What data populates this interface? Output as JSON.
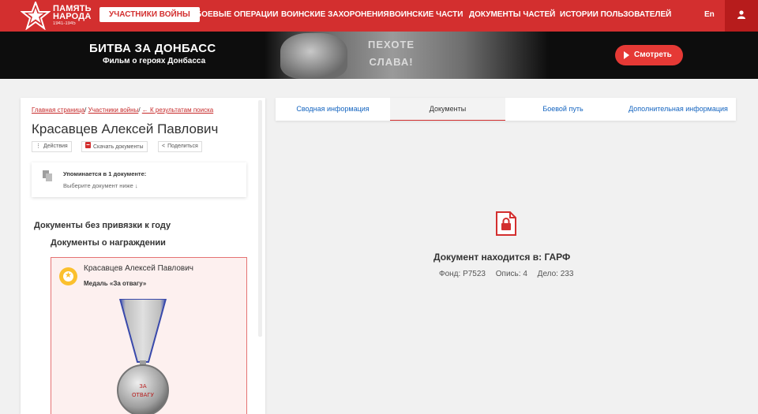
{
  "nav": {
    "logo": {
      "line1": "ПАМЯТЬ",
      "line2": "НАРОДА",
      "years": "1941-1945"
    },
    "items": [
      {
        "label": "УЧАСТНИКИ ВОЙНЫ"
      },
      {
        "label": "БОЕВЫЕ ОПЕРАЦИИ"
      },
      {
        "label": "ВОИНСКИЕ ЗАХОРОНЕНИЯ"
      },
      {
        "label": "ВОИНСКИЕ ЧАСТИ"
      },
      {
        "label": "ДОКУМЕНТЫ ЧАСТЕЙ"
      },
      {
        "label": "ИСТОРИИ ПОЛЬЗОВАТЕЛЕЙ"
      }
    ],
    "lang": "En",
    "icons": {
      "user": "user-icon"
    }
  },
  "banner": {
    "title": "БИТВА ЗА ДОНБАСС",
    "subtitle": "Фильм о героях Донбасса",
    "engrave_line1": "ПЕХОТЕ",
    "engrave_line2": "СЛАВА!",
    "button": "Смотреть"
  },
  "breadcrumb": {
    "home": "Главная страница",
    "section": "Участники войны",
    "back": "← К результатам поиска",
    "separator": "/"
  },
  "person": {
    "name": "Красавцев Алексей Павлович",
    "actions": {
      "menu": "Действия",
      "download": "Скачать документы",
      "share": "Поделиться"
    }
  },
  "mention": {
    "title": "Упоминается в 1 документе:",
    "hint": "Выберите документ ниже ↓"
  },
  "documents": {
    "year_group": "Документы без привязки к году",
    "category": "Документы о награждении",
    "award": {
      "name": "Красавцев Алексей Павлович",
      "medal": "Медаль «За отвагу»",
      "medal_inscription_1": "ЗА",
      "medal_inscription_2": "ОТВАГУ"
    }
  },
  "tabs": [
    {
      "label": "Сводная информация"
    },
    {
      "label": "Документы"
    },
    {
      "label": "Боевой путь"
    },
    {
      "label": "Дополнительная информация"
    }
  ],
  "document_view": {
    "location": "Документ находится в: ГАРФ",
    "fond": "Фонд: Р7523",
    "opis": "Опись: 4",
    "delo": "Дело: 233"
  },
  "colors": {
    "brand": "#d32f2f",
    "link": "#1565c0",
    "award_border": "#e57373"
  }
}
